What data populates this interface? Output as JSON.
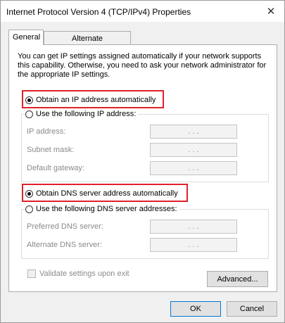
{
  "window": {
    "title": "Internet Protocol Version 4 (TCP/IPv4) Properties",
    "close_glyph": "✕"
  },
  "tabs": [
    {
      "label": "General",
      "active": true
    },
    {
      "label": "Alternate Configuration",
      "active": false
    }
  ],
  "description": "You can get IP settings assigned automatically if your network supports this capability. Otherwise, you need to ask your network administrator for the appropriate IP settings.",
  "ip_section": {
    "auto_label": "Obtain an IP address automatically",
    "auto_selected": true,
    "manual_label": "Use the following IP address:",
    "fields": [
      {
        "label": "IP address:",
        "value": ".   .   ."
      },
      {
        "label": "Subnet mask:",
        "value": ".   .   ."
      },
      {
        "label": "Default gateway:",
        "value": ".   .   ."
      }
    ]
  },
  "dns_section": {
    "auto_label": "Obtain DNS server address automatically",
    "auto_selected": true,
    "manual_label": "Use the following DNS server addresses:",
    "fields": [
      {
        "label": "Preferred DNS server:",
        "value": ".   .   ."
      },
      {
        "label": "Alternate DNS server:",
        "value": ".   .   ."
      }
    ]
  },
  "validate_label": "Validate settings upon exit",
  "advanced_label": "Advanced...",
  "ok_label": "OK",
  "cancel_label": "Cancel",
  "colors": {
    "highlight_box": "#e0212a",
    "disabled_text": "#8a8a8a"
  }
}
